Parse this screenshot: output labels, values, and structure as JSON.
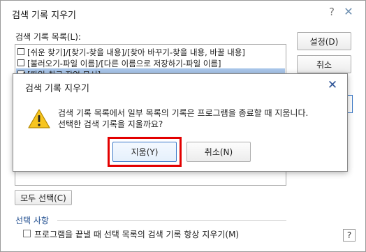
{
  "window": {
    "title": "검색 기록 지우기",
    "help_glyph": "?",
    "close_glyph": "✕"
  },
  "list": {
    "label": "검색 기록 목록(L):",
    "items": [
      {
        "label": "[쉬운 찾기]/[찾기-찾을 내용]/[찾아 바꾸기-찾을 내용, 바꿀 내용]",
        "checked": false
      },
      {
        "label": "[불러오기-파일 이름]/[다른 이름으로 저장하기-파일 이름]",
        "checked": false
      },
      {
        "label": "[파일-최근 작업 문서]",
        "checked": true,
        "selected": true
      }
    ]
  },
  "buttons": {
    "settings": "설정(D)",
    "cancel": "취소",
    "select_all": "모두 선택(C)"
  },
  "options": {
    "section_title": "선택 사항",
    "clear_on_exit": "프로그램을 끝낼 때 선택 목록의 검색 기록 항상 지우기(M)",
    "clear_on_exit_checked": false
  },
  "corner_help": "?",
  "dialog": {
    "title": "검색 기록 지우기",
    "close_glyph": "✕",
    "message_line1": "검색 기록 목록에서 일부 목록의 기록은 프로그램을 종료할 때 지웁니다.",
    "message_line2": "선택한 검색 기록을 지울까요?",
    "confirm": "지움(Y)",
    "deny": "취소(N)",
    "highlight_color": "#e30000"
  }
}
